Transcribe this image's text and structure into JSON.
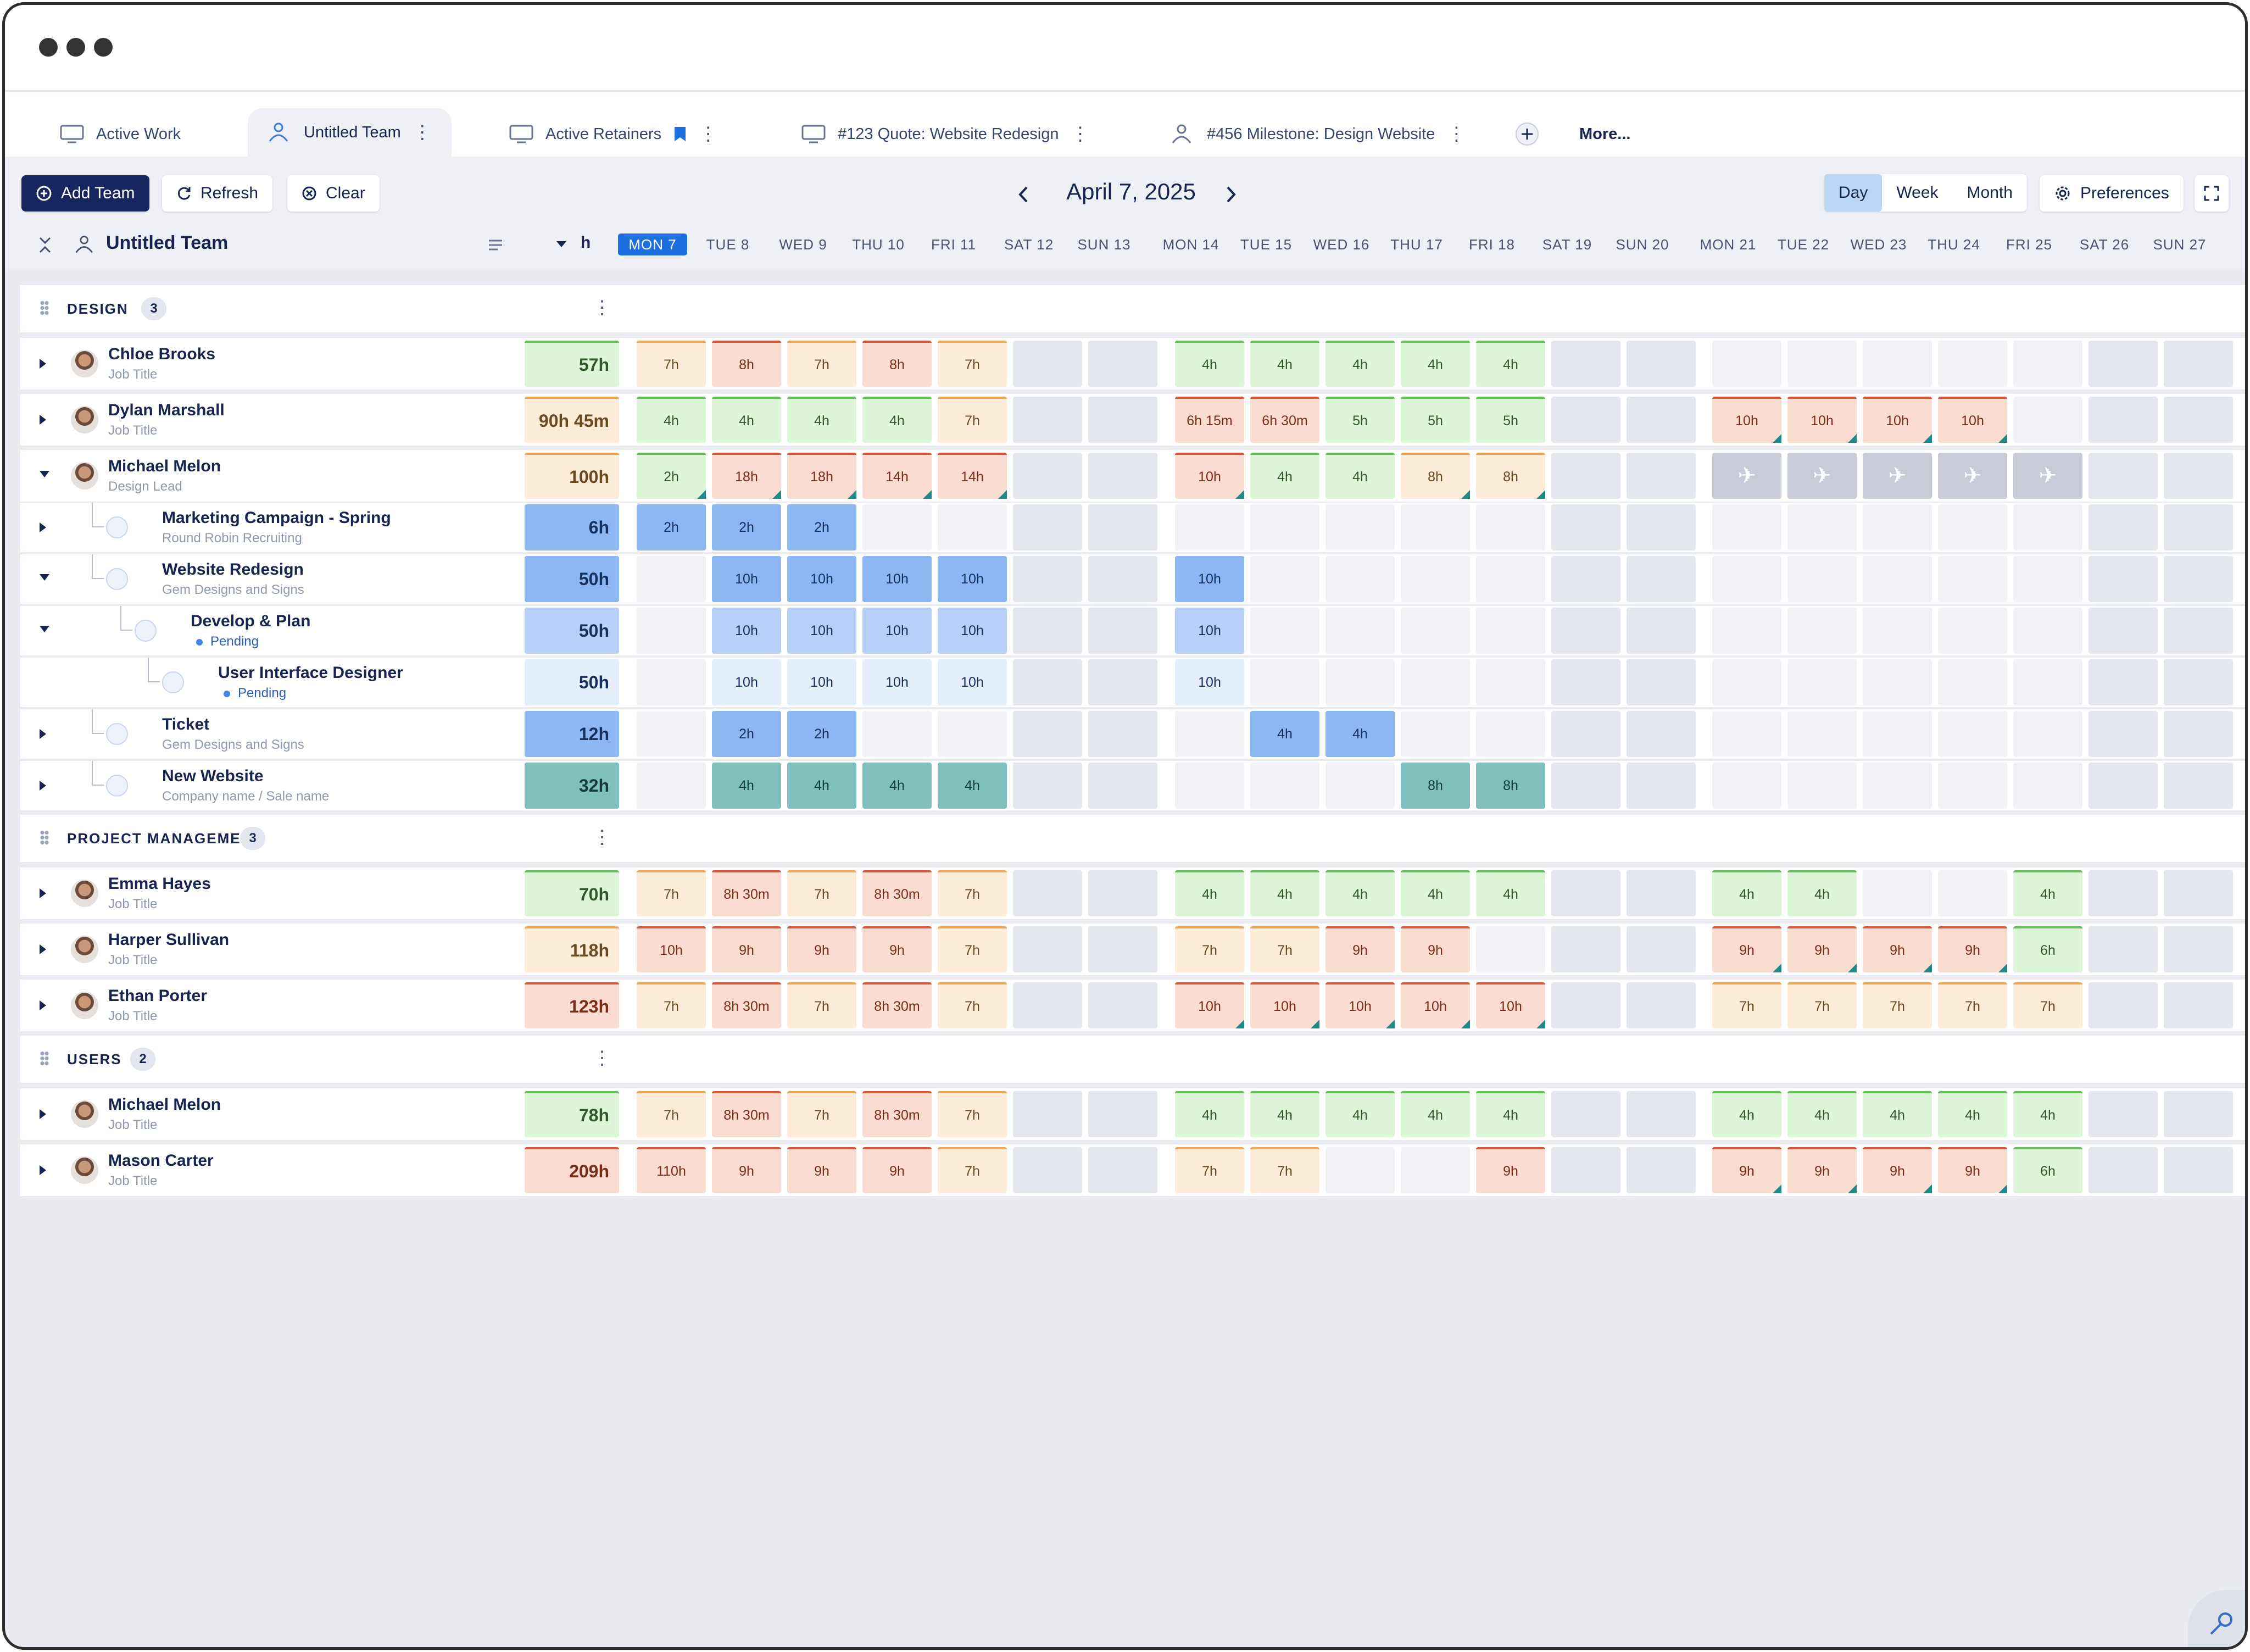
{
  "tabs": [
    {
      "label": "Active Work",
      "icon": "monitor-icon"
    },
    {
      "label": "Untitled Team",
      "icon": "team-icon",
      "active": true
    },
    {
      "label": "Active Retainers",
      "icon": "monitor-icon"
    },
    {
      "label": "#123 Quote: Website Redesign",
      "icon": "monitor-icon"
    },
    {
      "label": "#456 Milestone: Design Website",
      "icon": "team-icon"
    }
  ],
  "more_label": "More...",
  "toolbar": {
    "add_team": "Add Team",
    "refresh": "Refresh",
    "clear": "Clear",
    "date": "April 7, 2025",
    "views": [
      "Day",
      "Week",
      "Month"
    ],
    "active_view": "Day",
    "preferences": "Preferences"
  },
  "header": {
    "team_name": "Untitled Team",
    "unit": "h",
    "days": [
      "MON 7",
      "TUE 8",
      "WED 9",
      "THU 10",
      "FRI 11",
      "SAT 12",
      "SUN 13",
      "MON 14",
      "TUE 15",
      "WED 16",
      "THU 17",
      "FRI 18",
      "SAT 19",
      "SUN 20",
      "MON 21",
      "TUE 22",
      "WED 23",
      "THU 24",
      "FRI 25",
      "SAT 26",
      "SUN 27"
    ]
  },
  "groups": [
    {
      "name": "DESIGN",
      "count": "3"
    },
    {
      "name": "PROJECT MANAGEMENT",
      "count": "3"
    },
    {
      "name": "USERS",
      "count": "2"
    }
  ],
  "rows": [
    {
      "name": "Chloe Brooks",
      "sub": "Job Title",
      "total": "57h",
      "cells": [
        "o:7h",
        "r:8h",
        "o:7h",
        "r:8h",
        "o:7h",
        "e",
        "e",
        "g:4h",
        "g:4h",
        "g:4h",
        "g:4h",
        "g:4h",
        "e",
        "e",
        "f",
        "f",
        "f",
        "f",
        "f",
        "e",
        "e"
      ]
    },
    {
      "name": "Dylan Marshall",
      "sub": "Job Title",
      "total": "90h 45m",
      "cells": [
        "g:4h",
        "g:4h",
        "g:4h",
        "g:4h",
        "o:7h",
        "e",
        "e",
        "r:6h 15m",
        "r:6h 30m",
        "g:5h",
        "g:5h",
        "g:5h",
        "e",
        "e",
        "r:10h",
        "r:10h",
        "r:10h",
        "r:10h",
        "f",
        "e",
        "e"
      ]
    },
    {
      "name": "Michael Melon",
      "sub": "Design Lead",
      "total": "100h",
      "cells": [
        "g:2h",
        "r:18h",
        "r:18h",
        "r:14h",
        "r:14h",
        "e",
        "e",
        "r:10h",
        "g:4h",
        "g:4h",
        "o:8h",
        "o:8h",
        "e",
        "e",
        "v:✈",
        "v:✈",
        "v:✈",
        "v:✈",
        "v:✈",
        "e",
        "e"
      ]
    },
    {
      "name": "Marketing Campaign - Spring",
      "sub": "Round Robin Recruiting",
      "total": "6h",
      "cells": [
        "b1:2h",
        "b1:2h",
        "b1:2h",
        "f",
        "f",
        "e",
        "e",
        "f",
        "f",
        "f",
        "f",
        "f",
        "e",
        "e",
        "f",
        "f",
        "f",
        "f",
        "f",
        "e",
        "e"
      ]
    },
    {
      "name": "Website Redesign",
      "sub": "Gem Designs and Signs",
      "total": "50h",
      "cells": [
        "f",
        "b1:10h",
        "b1:10h",
        "b1:10h",
        "b1:10h",
        "e",
        "e",
        "b1:10h",
        "f",
        "f",
        "f",
        "f",
        "e",
        "e",
        "f",
        "f",
        "f",
        "f",
        "f",
        "e",
        "e"
      ]
    },
    {
      "name": "Develop & Plan",
      "sub": "Pending",
      "total": "50h",
      "cells": [
        "f",
        "b2:10h",
        "b2:10h",
        "b2:10h",
        "b2:10h",
        "e",
        "e",
        "b2:10h",
        "f",
        "f",
        "f",
        "f",
        "e",
        "e",
        "f",
        "f",
        "f",
        "f",
        "f",
        "e",
        "e"
      ]
    },
    {
      "name": "User Interface Designer",
      "sub": "Pending",
      "total": "50h",
      "cells": [
        "f",
        "b3:10h",
        "b3:10h",
        "b3:10h",
        "b3:10h",
        "e",
        "e",
        "b3:10h",
        "f",
        "f",
        "f",
        "f",
        "e",
        "e",
        "f",
        "f",
        "f",
        "f",
        "f",
        "e",
        "e"
      ]
    },
    {
      "name": "Ticket",
      "sub": "Gem Designs and Signs",
      "total": "12h",
      "cells": [
        "f",
        "b1:2h",
        "b1:2h",
        "f",
        "f",
        "e",
        "e",
        "f",
        "b1:4h",
        "b1:4h",
        "f",
        "f",
        "e",
        "e",
        "f",
        "f",
        "f",
        "f",
        "f",
        "e",
        "e"
      ]
    },
    {
      "name": "New Website",
      "sub": "Company name / Sale name",
      "total": "32h",
      "cells": [
        "f",
        "t:4h",
        "t:4h",
        "t:4h",
        "t:4h",
        "e",
        "e",
        "f",
        "f",
        "f",
        "t:8h",
        "t:8h",
        "e",
        "e",
        "f",
        "f",
        "f",
        "f",
        "f",
        "e",
        "e"
      ]
    },
    {
      "name": "Emma Hayes",
      "sub": "Job Title",
      "total": "70h",
      "cells": [
        "o:7h",
        "r:8h 30m",
        "o:7h",
        "r:8h 30m",
        "o:7h",
        "e",
        "e",
        "g:4h",
        "g:4h",
        "g:4h",
        "g:4h",
        "g:4h",
        "e",
        "e",
        "g:4h",
        "g:4h",
        "f",
        "f",
        "g:4h",
        "e",
        "e"
      ]
    },
    {
      "name": "Harper Sullivan",
      "sub": "Job Title",
      "total": "118h",
      "cells": [
        "r:10h",
        "r:9h",
        "r:9h",
        "r:9h",
        "o:7h",
        "e",
        "e",
        "o:7h",
        "o:7h",
        "r:9h",
        "r:9h",
        "f",
        "e",
        "e",
        "r:9h",
        "r:9h",
        "r:9h",
        "r:9h",
        "g:6h",
        "e",
        "e"
      ]
    },
    {
      "name": "Ethan Porter",
      "sub": "Job Title",
      "total": "123h",
      "cells": [
        "o:7h",
        "r:8h 30m",
        "o:7h",
        "r:8h 30m",
        "o:7h",
        "e",
        "e",
        "r:10h",
        "r:10h",
        "r:10h",
        "r:10h",
        "r:10h",
        "e",
        "e",
        "o:7h",
        "o:7h",
        "o:7h",
        "o:7h",
        "o:7h",
        "e",
        "e"
      ]
    },
    {
      "name": "Michael Melon",
      "sub": "Job Title",
      "total": "78h",
      "cells": [
        "o:7h",
        "r:8h 30m",
        "o:7h",
        "r:8h 30m",
        "o:7h",
        "e",
        "e",
        "g:4h",
        "g:4h",
        "g:4h",
        "g:4h",
        "g:4h",
        "e",
        "e",
        "g:4h",
        "g:4h",
        "g:4h",
        "g:4h",
        "g:4h",
        "e",
        "e"
      ]
    },
    {
      "name": "Mason Carter",
      "sub": "Job Title",
      "total": "209h",
      "cells": [
        "r:110h",
        "r:9h",
        "r:9h",
        "r:9h",
        "o:7h",
        "e",
        "e",
        "o:7h",
        "o:7h",
        "f",
        "f",
        "r:9h",
        "e",
        "e",
        "r:9h",
        "r:9h",
        "r:9h",
        "r:9h",
        "g:6h",
        "e",
        "e"
      ]
    }
  ]
}
